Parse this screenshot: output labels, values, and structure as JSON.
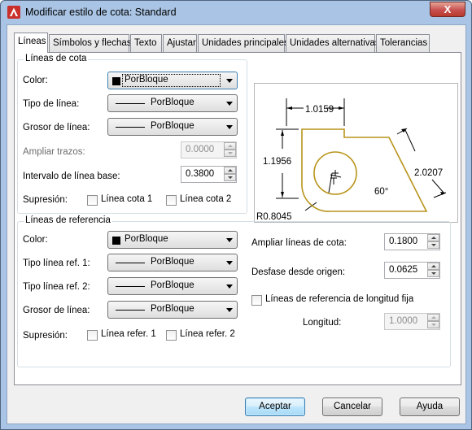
{
  "window": {
    "title": "Modificar estilo de cota: Standard",
    "close_symbol": "X"
  },
  "tabs": [
    {
      "label": "Líneas"
    },
    {
      "label": "Símbolos y flechas"
    },
    {
      "label": "Texto"
    },
    {
      "label": "Ajustar"
    },
    {
      "label": "Unidades principales"
    },
    {
      "label": "Unidades alternativas"
    },
    {
      "label": "Tolerancias"
    }
  ],
  "dim_lines": {
    "title": "Líneas de cota",
    "color_label": "Color:",
    "color_value": "PorBloque",
    "linetype_label": "Tipo de línea:",
    "linetype_value": "PorBloque",
    "lineweight_label": "Grosor de línea:",
    "lineweight_value": "PorBloque",
    "extend_label": "Ampliar trazos:",
    "extend_value": "0.0000",
    "baseline_label": "Intervalo de línea base:",
    "baseline_value": "0.3800",
    "suppress_label": "Supresión:",
    "suppress_1": "Línea cota 1",
    "suppress_2": "Línea cota 2"
  },
  "ext_lines": {
    "title": "Líneas de referencia",
    "color_label": "Color:",
    "color_value": "PorBloque",
    "linetype1_label": "Tipo línea ref. 1:",
    "linetype1_value": "PorBloque",
    "linetype2_label": "Tipo línea ref. 2:",
    "linetype2_value": "PorBloque",
    "lineweight_label": "Grosor de línea:",
    "lineweight_value": "PorBloque",
    "suppress_label": "Supresión:",
    "suppress_1": "Línea refer. 1",
    "suppress_2": "Línea refer. 2",
    "extend_label": "Ampliar líneas de cota:",
    "extend_value": "0.1800",
    "offset_label": "Desfase desde origen:",
    "offset_value": "0.0625",
    "fixed_label": "Líneas de referencia de longitud fija",
    "length_label": "Longitud:",
    "length_value": "1.0000"
  },
  "preview": {
    "dim_top": "1.0159",
    "dim_left": "1.1956",
    "dim_right": "2.0207",
    "dim_angle": "60°",
    "dim_radius": "R0.8045",
    "outline_color": "#b8941a"
  },
  "buttons": {
    "ok": "Aceptar",
    "cancel": "Cancelar",
    "help": "Ayuda"
  }
}
